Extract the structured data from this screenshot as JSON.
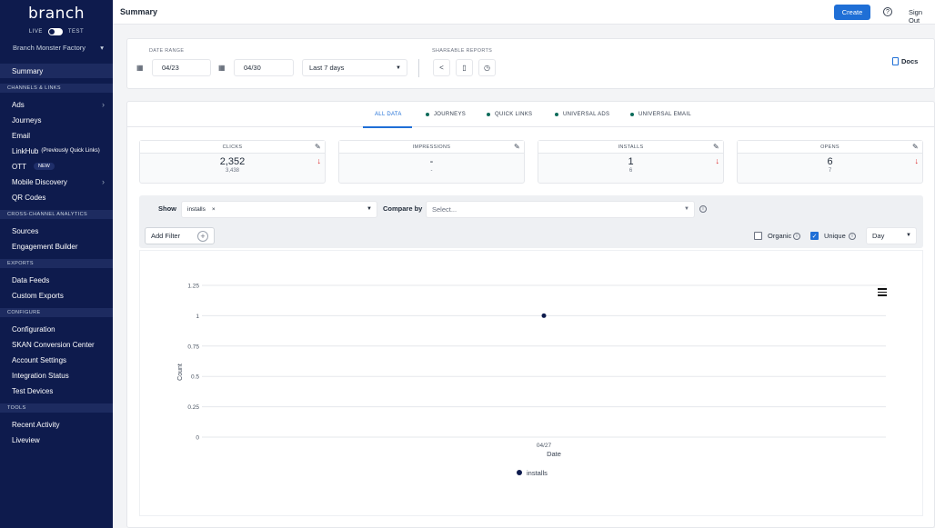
{
  "sidebar": {
    "logo": "branch",
    "env": {
      "live": "LIVE",
      "test": "TEST"
    },
    "org": "Branch Monster Factory",
    "summary": "Summary",
    "sections": {
      "channels": "CHANNELS & LINKS",
      "cross": "CROSS-CHANNEL ANALYTICS",
      "exports": "EXPORTS",
      "configure": "CONFIGURE",
      "tools": "TOOLS"
    },
    "items": {
      "ads": "Ads",
      "journeys": "Journeys",
      "email": "Email",
      "linkhub": "LinkHub",
      "linkhub_sub": "(Previously Quick Links)",
      "ott": "OTT",
      "ott_badge": "NEW",
      "mobile_discovery": "Mobile Discovery",
      "qr_codes": "QR Codes",
      "sources": "Sources",
      "engagement_builder": "Engagement Builder",
      "data_feeds": "Data Feeds",
      "custom_exports": "Custom Exports",
      "configuration": "Configuration",
      "skan": "SKAN Conversion Center",
      "account_settings": "Account Settings",
      "integration_status": "Integration Status",
      "test_devices": "Test Devices",
      "recent_activity": "Recent Activity",
      "liveview": "Liveview"
    }
  },
  "topbar": {
    "title": "Summary",
    "create": "Create",
    "help": "?",
    "signout": "Sign Out"
  },
  "filters": {
    "date_range_label": "DATE RANGE",
    "start": "04/23",
    "end": "04/30",
    "range": "Last 7 days",
    "shareable_label": "SHAREABLE REPORTS",
    "docs": "Docs"
  },
  "tabs": [
    "ALL DATA",
    "JOURNEYS",
    "QUICK LINKS",
    "UNIVERSAL ADS",
    "UNIVERSAL EMAIL"
  ],
  "kpis": [
    {
      "label": "CLICKS",
      "value": "2,352",
      "sub": "3,438",
      "arrow": "↓"
    },
    {
      "label": "IMPRESSIONS",
      "value": "-",
      "sub": "-",
      "arrow": ""
    },
    {
      "label": "INSTALLS",
      "value": "1",
      "sub": "6",
      "arrow": "↓"
    },
    {
      "label": "OPENS",
      "value": "6",
      "sub": "7",
      "arrow": "↓"
    }
  ],
  "controls": {
    "show_label": "Show",
    "show_chip": "installs",
    "compare_label": "Compare by",
    "compare_placeholder": "Select...",
    "add_filter": "Add Filter",
    "organic": "Organic",
    "unique": "Unique",
    "granularity": "Day"
  },
  "chart_data": {
    "type": "scatter",
    "x": [
      "04/27"
    ],
    "series": [
      {
        "name": "installs",
        "values": [
          1
        ]
      }
    ],
    "xlabel": "Date",
    "ylabel": "Count",
    "ylim": [
      0,
      1.25
    ],
    "yticks": [
      "0",
      "0.25",
      "0.5",
      "0.75",
      "1",
      "1.25"
    ],
    "grid": true,
    "legend": "bottom",
    "color": "#0e1b4d"
  }
}
